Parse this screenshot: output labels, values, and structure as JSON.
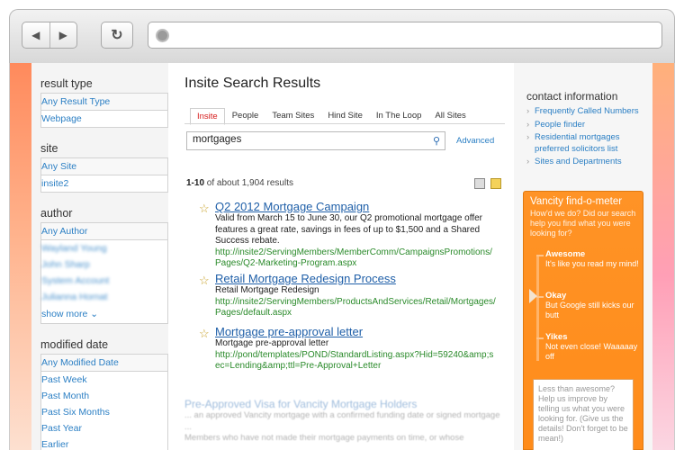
{
  "page": {
    "title": "Insite Search Results"
  },
  "facets": [
    {
      "heading": "result type",
      "items": [
        "Any Result Type",
        "Webpage"
      ]
    },
    {
      "heading": "site",
      "items": [
        "Any Site",
        "insite2"
      ]
    },
    {
      "heading": "author",
      "items": [
        "Any Author",
        "Wayland Young",
        "John Sharp",
        "System Account",
        "Julianna Hornat"
      ],
      "more": "show more"
    },
    {
      "heading": "modified date",
      "items": [
        "Any Modified Date",
        "Past Week",
        "Past Month",
        "Past Six Months",
        "Past Year",
        "Earlier"
      ]
    }
  ],
  "tabs": [
    "Insite",
    "People",
    "Team Sites",
    "Hind Site",
    "In The Loop",
    "All Sites"
  ],
  "search": {
    "value": "mortgages",
    "advanced": "Advanced"
  },
  "count": {
    "range": "1-10",
    "rest": " of about 1,904 results"
  },
  "results": [
    {
      "title": "Q2 2012 Mortgage Campaign",
      "desc": "Valid from March 15 to June 30, our Q2 promotional mortgage offer features a great rate, savings in fees of up to $1,500 and a Shared Success rebate.",
      "url": "http://insite2/ServingMembers/MemberComm/CampaignsPromotions/Pages/Q2-Marketing-Program.aspx"
    },
    {
      "title": "Retail Mortgage Redesign Process",
      "desc": "Retail Mortgage Redesign",
      "url": "http://insite2/ServingMembers/ProductsAndServices/Retail/Mortgages/Pages/default.aspx"
    },
    {
      "title": "Mortgage pre-approval letter",
      "desc": "Mortgage pre-approval letter",
      "url": "http://pond/templates/POND/StandardListing.aspx?Hid=59240&amp;sec=Lending&amp;ttl=Pre-Approval+Letter"
    }
  ],
  "faded": {
    "title": "Pre-Approved Visa for Vancity Mortgage Holders",
    "line1": "... an approved Vancity mortgage with a confirmed funding date or signed mortgage ...",
    "line2": "Members who have not made their mortgage payments on time, or whose"
  },
  "contact": {
    "heading": "contact information",
    "links": [
      "Frequently Called Numbers",
      "People finder",
      "Residential mortgages preferred solicitors list",
      "Sites and Departments"
    ]
  },
  "meter": {
    "title": "Vancity find-o-meter",
    "question": "How'd we do? Did our search help you find what you were looking for?",
    "options": [
      {
        "label": "Awesome",
        "text": "It's like you read my mind!"
      },
      {
        "label": "Okay",
        "text": "But Google still kicks our butt"
      },
      {
        "label": "Yikes",
        "text": "Not even close! Waaaaay off"
      }
    ],
    "feedback": "Less than awesome? Help us improve by telling us what you were looking for. (Give us the details! Don't forget to be mean!)"
  },
  "colors": {
    "accent": "#ff8c1a",
    "link": "#2b7fc4",
    "url": "#2a8a2a",
    "activeTab": "#d61c1c"
  }
}
